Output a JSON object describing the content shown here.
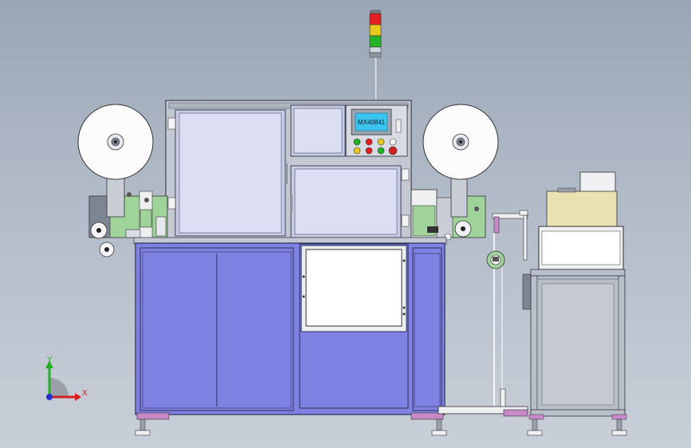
{
  "hmi": {
    "screen_text": "MX40841"
  },
  "axes": {
    "x_label": "X",
    "y_label": "Y"
  },
  "colors": {
    "cabinet": "#7f82e3",
    "panel": "#d9dbf5",
    "frame": "#b9bfcb",
    "frame_dark": "#6e7686",
    "green_plate": "#9fd39a",
    "machine_grey": "#7d8592",
    "tank": "#e8e2b3",
    "lamp_red": "#e52020",
    "lamp_yellow": "#e6c81f",
    "lamp_green": "#24b324",
    "axis_x": "#d42020",
    "axis_y": "#20b020",
    "axis_z": "#2030d0"
  }
}
